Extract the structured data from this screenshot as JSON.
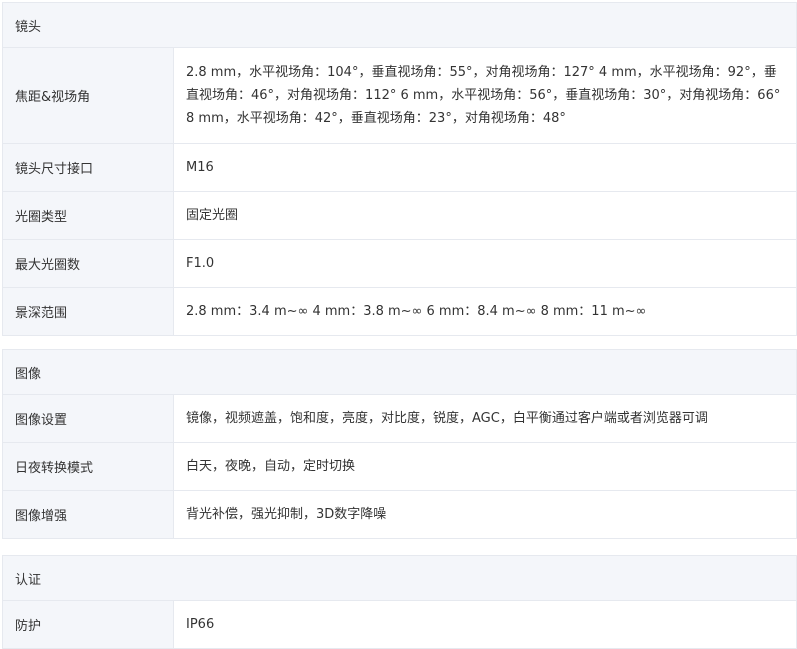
{
  "lens": {
    "title": "镜头",
    "rows": [
      {
        "key": "焦距&视场角",
        "value": "2.8 mm，水平视场角：104°，垂直视场角：55°，对角视场角：127° 4 mm，水平视场角：92°，垂直视场角：46°，对角视场角：112° 6 mm，水平视场角：56°，垂直视场角：30°，对角视场角：66° 8 mm，水平视场角：42°，垂直视场角：23°，对角视场角：48°"
      },
      {
        "key": "镜头尺寸接口",
        "value": "M16"
      },
      {
        "key": "光圈类型",
        "value": "固定光圈"
      },
      {
        "key": "最大光圈数",
        "value": "F1.0"
      },
      {
        "key": "景深范围",
        "value": "2.8 mm：3.4 m~∞ 4 mm：3.8 m~∞ 6 mm：8.4 m~∞ 8 mm：11 m~∞"
      }
    ]
  },
  "image": {
    "title": "图像",
    "rows": [
      {
        "key": "图像设置",
        "value": "镜像，视频遮盖，饱和度，亮度，对比度，锐度，AGC，白平衡通过客户端或者浏览器可调"
      },
      {
        "key": "日夜转换模式",
        "value": "白天，夜晚，自动，定时切换"
      },
      {
        "key": "图像增强",
        "value": "背光补偿，强光抑制，3D数字降噪"
      }
    ]
  },
  "cert": {
    "title": "认证",
    "rows": [
      {
        "key": "防护",
        "value": "IP66"
      }
    ]
  }
}
